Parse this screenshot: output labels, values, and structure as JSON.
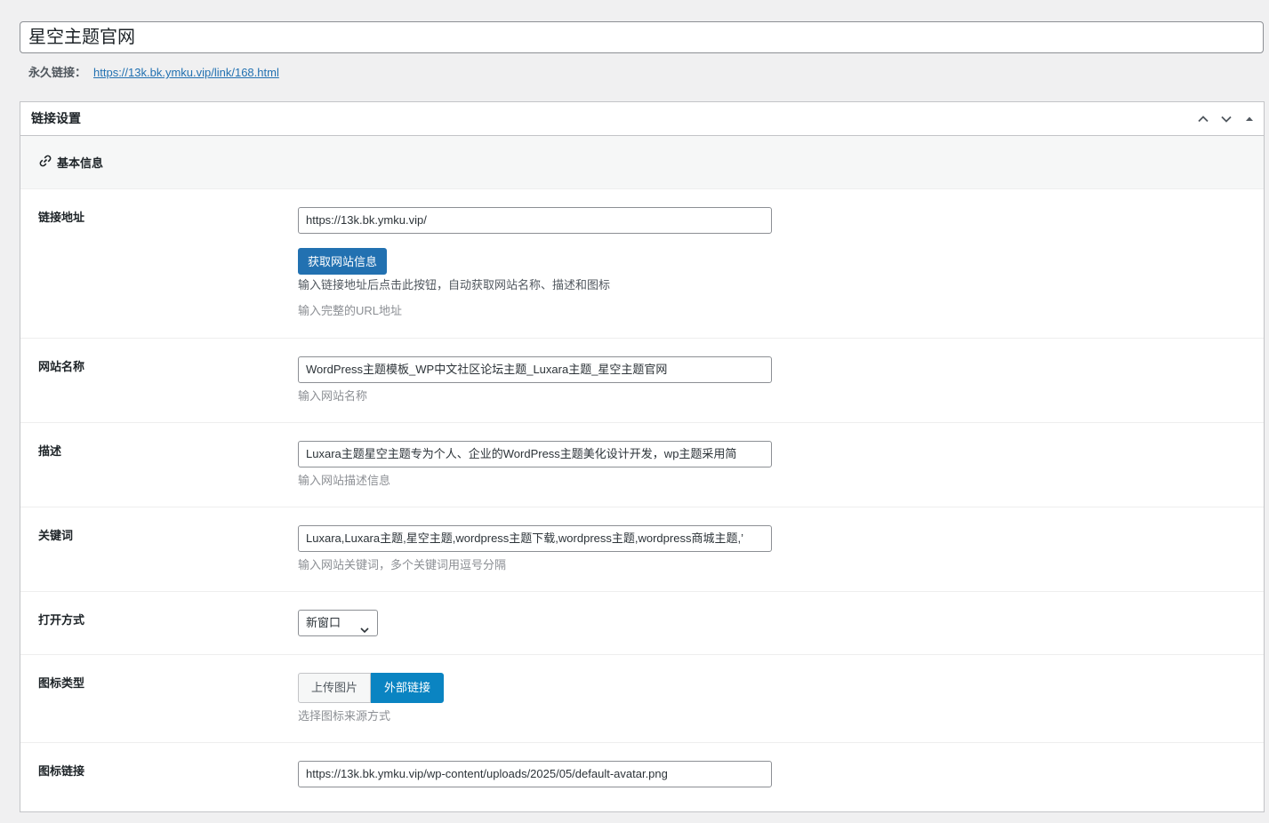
{
  "post_title": "星空主题官网",
  "permalink": {
    "label": "永久链接：",
    "url": "https://13k.bk.ymku.vip/link/168.html"
  },
  "metabox": {
    "title": "链接设置",
    "section_title": "基本信息",
    "fields": {
      "url": {
        "label": "链接地址",
        "value": "https://13k.bk.ymku.vip/",
        "button": "获取网站信息",
        "help": "输入链接地址后点击此按钮，自动获取网站名称、描述和图标",
        "desc": "输入完整的URL地址"
      },
      "site_name": {
        "label": "网站名称",
        "value": "WordPress主题模板_WP中文社区论坛主题_Luxara主题_星空主题官网",
        "desc": "输入网站名称"
      },
      "description": {
        "label": "描述",
        "value": "Luxara主题星空主题专为个人、企业的WordPress主题美化设计开发，wp主题采用简",
        "desc": "输入网站描述信息"
      },
      "keywords": {
        "label": "关键词",
        "value": "Luxara,Luxara主题,星空主题,wordpress主题下载,wordpress主题,wordpress商城主题,’",
        "desc": "输入网站关键词，多个关键词用逗号分隔"
      },
      "open_mode": {
        "label": "打开方式",
        "selected": "新窗口"
      },
      "icon_type": {
        "label": "图标类型",
        "options": [
          "上传图片",
          "外部链接"
        ],
        "active": "外部链接",
        "desc": "选择图标来源方式"
      },
      "icon_link": {
        "label": "图标链接",
        "value": "https://13k.bk.ymku.vip/wp-content/uploads/2025/05/default-avatar.png"
      }
    }
  },
  "colors": {
    "primary": "#2271b1",
    "active_toggle": "#0a84c2",
    "background": "#f0f0f1"
  },
  "icons": {
    "section": "link-icon",
    "handles": [
      "chevron-up-icon",
      "chevron-down-icon",
      "triangle-up-icon"
    ],
    "select": "chevron-down-icon"
  }
}
